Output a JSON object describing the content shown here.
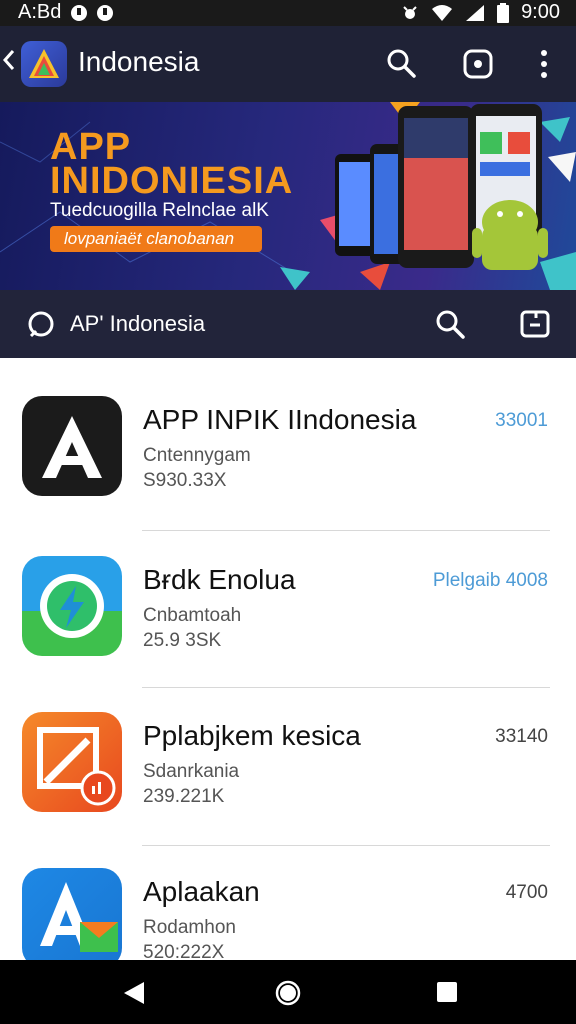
{
  "status_bar": {
    "left_text": "A:Bd",
    "time": "9:00"
  },
  "app_bar": {
    "title": "Indonesia"
  },
  "banner": {
    "title_line1": "APP",
    "title_line2": "INIDONIESIA",
    "subtitle": "Tuedcuogilla Relnclae alK",
    "button_label": "lovpaniaët clanobanan"
  },
  "search_bar": {
    "title": "AP' Indonesia"
  },
  "apps": [
    {
      "name": "APP INPIK IIndonesia",
      "developer": "Cntennygam",
      "size": "S930.33X",
      "right": "33001",
      "right_color": "#4d9bd6"
    },
    {
      "name": "Bɍdk Enolua",
      "developer": "Cnbamtoah",
      "size": "25.9 3SK",
      "right": "Plelgaib 4008",
      "right_color": "#4d9bd6"
    },
    {
      "name": "Pplabjkem kesica",
      "developer": "Sdanrkania",
      "size": "239.221K",
      "right": "33140",
      "right_color": "#444444"
    },
    {
      "name": "Aplaakan",
      "developer": "Rodamhon",
      "size": "520:222X",
      "right": "4700",
      "right_color": "#444444"
    }
  ],
  "colors": {
    "app_bar": "#1f2236",
    "banner_accent": "#f59a1f",
    "link_blue": "#4d9bd6"
  }
}
